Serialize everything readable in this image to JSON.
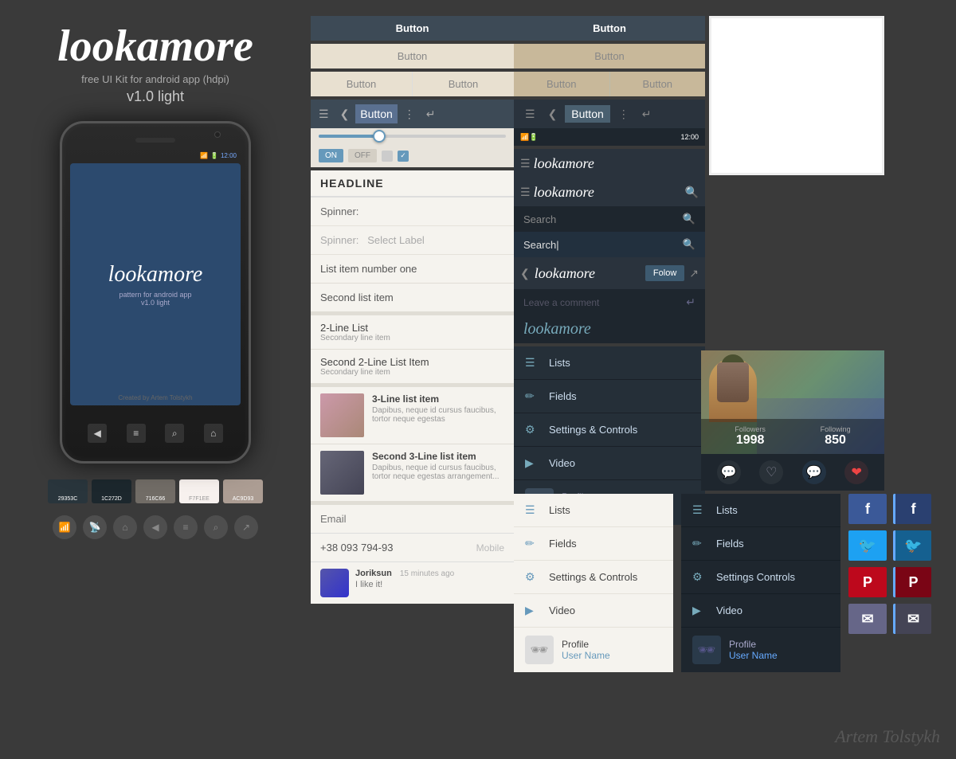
{
  "brand": {
    "name": "lookamore",
    "tagline": "free UI Kit for android app (hdpi)",
    "version": "v1.0 light",
    "screen_logo": "lookamore",
    "screen_tagline": "pattern for android app",
    "screen_version": "v1.0 light",
    "credit": "Created by Artem Tolstykh",
    "watermark": "Artem Tolstykh"
  },
  "colors": {
    "swatch1": "#29353C",
    "swatch1_label": "29353C",
    "swatch2": "#1C272D",
    "swatch2_label": "1C272D",
    "swatch3": "#716C66",
    "swatch3_label": "716C66",
    "swatch4": "#F7F1EE",
    "swatch4_label": "F7F1EE",
    "swatch5": "#AC9D93",
    "swatch5_label": "AC9D93"
  },
  "buttons": {
    "dark_label": "Button",
    "light_label": "Button",
    "tan_label": "Button",
    "half1_label": "Button",
    "half2_label": "Button",
    "half3_label": "Button",
    "half4_label": "Button"
  },
  "toggle": {
    "on_label": "ON",
    "off_label": "OFF"
  },
  "list_items": {
    "item1": "List item number one",
    "item2": "Second list item",
    "item2line_1_primary": "2-Line List",
    "item2line_1_secondary": "Secondary line item",
    "item2line_2_primary": "Second 2-Line List Item",
    "item2line_2_secondary": "Secondary line item",
    "item3line_1_primary": "3-Line list item",
    "item3line_1_secondary": "Dapibus, neque id cursus faucibus, tortor neque egestas",
    "item3line_2_primary": "Second 3-Line list item",
    "item3line_2_secondary": "Dapibus, neque id cursus faucibus, tortor neque egestas arrangement..."
  },
  "form": {
    "headline": "HEADLINE",
    "spinner_label": "Spinner:",
    "spinner_select": "Spinner:   Select Label",
    "email_placeholder": "Email",
    "phone_number": "+38 093 794-93",
    "phone_label": "Mobile"
  },
  "comment": {
    "user": "Joriksun",
    "time": "15 minutes ago",
    "text": "I like it!",
    "placeholder": "Leave a comment"
  },
  "search": {
    "placeholder1": "Search",
    "placeholder2": "Search",
    "active_text": "Search|"
  },
  "profile": {
    "followers_label": "Followers",
    "followers_count": "1998",
    "following_label": "Following",
    "following_count": "850",
    "follow_btn": "Folow",
    "username": "User Name",
    "name": "Profile"
  },
  "menu_items": {
    "lists": "Lists",
    "fields": "Fields",
    "settings": "Settings & Controls",
    "settings_dark": "Settings Controls",
    "video": "Video",
    "profile": "Profile"
  },
  "status_bar": {
    "time": "12:00"
  }
}
